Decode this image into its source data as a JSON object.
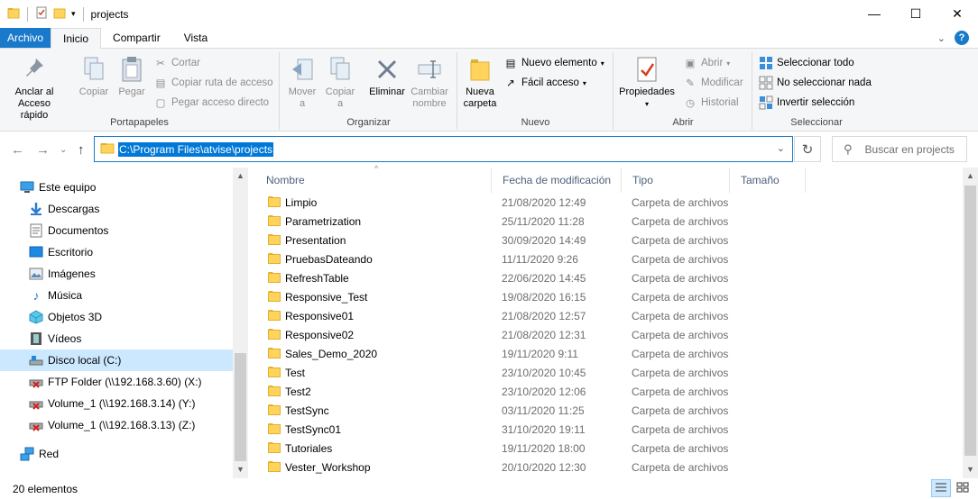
{
  "window": {
    "title": "projects",
    "controls": {
      "minimize": "—",
      "maximize": "☐",
      "close": "✕"
    }
  },
  "ribbon_tabs": [
    "Archivo",
    "Inicio",
    "Compartir",
    "Vista"
  ],
  "ribbon": {
    "portapapeles": {
      "label": "Portapapeles",
      "anclar": "Anclar al\nAcceso rápido",
      "copiar": "Copiar",
      "pegar": "Pegar",
      "cortar": "Cortar",
      "copiar_ruta": "Copiar ruta de acceso",
      "pegar_acceso": "Pegar acceso directo"
    },
    "organizar": {
      "label": "Organizar",
      "mover": "Mover\na",
      "copiar": "Copiar\na",
      "eliminar": "Eliminar",
      "cambiar": "Cambiar\nnombre"
    },
    "nuevo": {
      "label": "Nuevo",
      "nueva_carpeta": "Nueva\ncarpeta",
      "nuevo_elemento": "Nuevo elemento",
      "facil_acceso": "Fácil acceso"
    },
    "abrir": {
      "label": "Abrir",
      "propiedades": "Propiedades",
      "abrir": "Abrir",
      "modificar": "Modificar",
      "historial": "Historial"
    },
    "seleccionar": {
      "label": "Seleccionar",
      "todo": "Seleccionar todo",
      "nada": "No seleccionar nada",
      "invertir": "Invertir selección"
    }
  },
  "address": {
    "path": "C:\\Program Files\\atvise\\projects",
    "search_placeholder": "Buscar en projects"
  },
  "nav": [
    {
      "label": "Este equipo",
      "icon": "computer-icon"
    },
    {
      "label": "Descargas",
      "icon": "downloads-icon"
    },
    {
      "label": "Documentos",
      "icon": "documents-icon"
    },
    {
      "label": "Escritorio",
      "icon": "desktop-icon"
    },
    {
      "label": "Imágenes",
      "icon": "pictures-icon"
    },
    {
      "label": "Música",
      "icon": "music-icon"
    },
    {
      "label": "Objetos 3D",
      "icon": "3d-objects-icon"
    },
    {
      "label": "Vídeos",
      "icon": "videos-icon"
    },
    {
      "label": "Disco local (C:)",
      "icon": "drive-icon",
      "selected": true
    },
    {
      "label": "FTP Folder (\\\\192.168.3.60) (X:)",
      "icon": "network-drive-disconnected-icon"
    },
    {
      "label": "Volume_1 (\\\\192.168.3.14) (Y:)",
      "icon": "network-drive-disconnected-icon"
    },
    {
      "label": "Volume_1 (\\\\192.168.3.13) (Z:)",
      "icon": "network-drive-disconnected-icon"
    },
    {
      "label": "Red",
      "icon": "network-icon"
    }
  ],
  "columns": [
    "Nombre",
    "Fecha de modificación",
    "Tipo",
    "Tamaño"
  ],
  "files": [
    {
      "name": "Limpio",
      "date": "21/08/2020 12:49",
      "type": "Carpeta de archivos"
    },
    {
      "name": "Parametrization",
      "date": "25/11/2020 11:28",
      "type": "Carpeta de archivos"
    },
    {
      "name": "Presentation",
      "date": "30/09/2020 14:49",
      "type": "Carpeta de archivos"
    },
    {
      "name": "PruebasDateando",
      "date": "11/11/2020 9:26",
      "type": "Carpeta de archivos"
    },
    {
      "name": "RefreshTable",
      "date": "22/06/2020 14:45",
      "type": "Carpeta de archivos"
    },
    {
      "name": "Responsive_Test",
      "date": "19/08/2020 16:15",
      "type": "Carpeta de archivos"
    },
    {
      "name": "Responsive01",
      "date": "21/08/2020 12:57",
      "type": "Carpeta de archivos"
    },
    {
      "name": "Responsive02",
      "date": "21/08/2020 12:31",
      "type": "Carpeta de archivos"
    },
    {
      "name": "Sales_Demo_2020",
      "date": "19/11/2020 9:11",
      "type": "Carpeta de archivos"
    },
    {
      "name": "Test",
      "date": "23/10/2020 10:45",
      "type": "Carpeta de archivos"
    },
    {
      "name": "Test2",
      "date": "23/10/2020 12:06",
      "type": "Carpeta de archivos"
    },
    {
      "name": "TestSync",
      "date": "03/11/2020 11:25",
      "type": "Carpeta de archivos"
    },
    {
      "name": "TestSync01",
      "date": "31/10/2020 19:11",
      "type": "Carpeta de archivos"
    },
    {
      "name": "Tutoriales",
      "date": "19/11/2020 18:00",
      "type": "Carpeta de archivos"
    },
    {
      "name": "Vester_Workshop",
      "date": "20/10/2020 12:30",
      "type": "Carpeta de archivos"
    }
  ],
  "status": {
    "count": "20 elementos"
  },
  "colors": {
    "accent": "#1979ca",
    "selection": "#cce8ff",
    "folder": "#ffd35c"
  }
}
